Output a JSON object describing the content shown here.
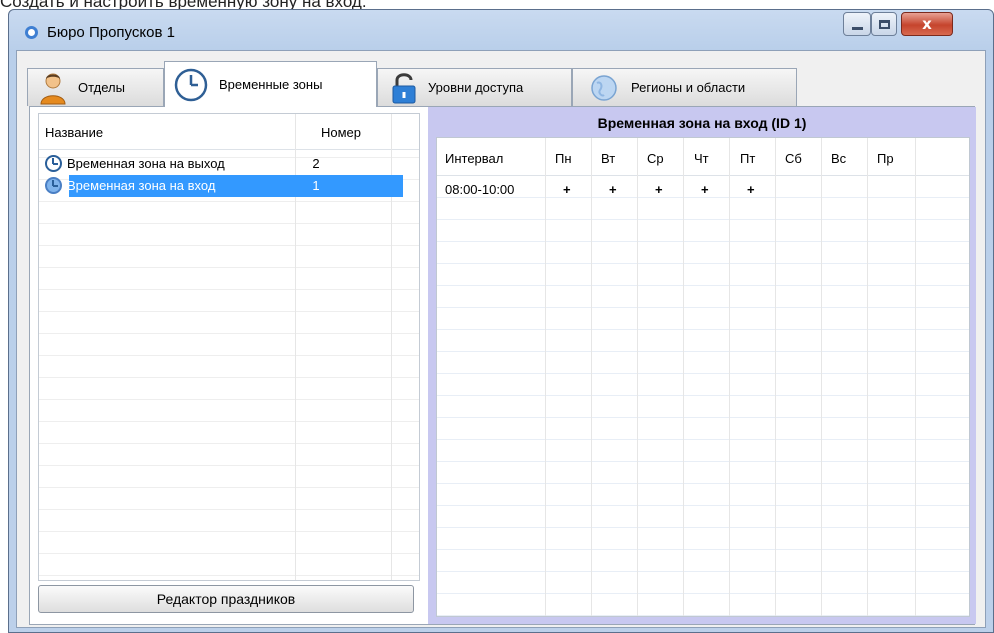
{
  "caption": "Создать и настроить временную зону на вход.",
  "window": {
    "title": "Бюро Пропусков 1",
    "close_glyph": "x"
  },
  "tabs": [
    {
      "label": "Отделы",
      "icon": "user-icon",
      "active": false
    },
    {
      "label": "Временные зоны",
      "icon": "clock-icon",
      "active": true
    },
    {
      "label": "Уровни доступа",
      "icon": "lock-icon",
      "active": false
    },
    {
      "label": "Регионы и области",
      "icon": "globe-icon",
      "active": false
    }
  ],
  "zones_table": {
    "columns": [
      "Название",
      "Номер"
    ],
    "rows": [
      {
        "name": "Временная зона на выход",
        "number": "2",
        "selected": false
      },
      {
        "name": "Временная зона на вход",
        "number": "1",
        "selected": true
      }
    ]
  },
  "holiday_button_label": "Редактор праздников",
  "zone_detail": {
    "title": "Временная зона на вход (ID 1)",
    "columns": [
      "Интервал",
      "Пн",
      "Вт",
      "Ср",
      "Чт",
      "Пт",
      "Сб",
      "Вс",
      "Пр"
    ],
    "rows": [
      {
        "interval": "08:00-10:00",
        "days": [
          "+",
          "+",
          "+",
          "+",
          "+",
          "",
          "",
          ""
        ]
      }
    ]
  },
  "colors": {
    "selection": "#3399ff",
    "detail_panel": "#c8c8f0",
    "close_button": "#c5442d"
  }
}
